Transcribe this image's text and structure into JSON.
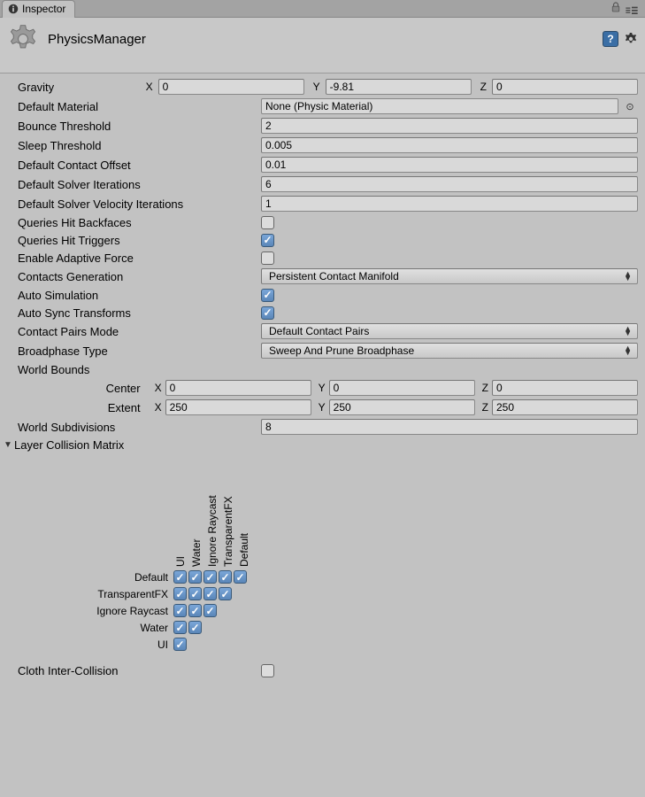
{
  "tab": {
    "title": "Inspector"
  },
  "header": {
    "title": "PhysicsManager"
  },
  "labels": {
    "gravity": "Gravity",
    "default_material": "Default Material",
    "bounce_threshold": "Bounce Threshold",
    "sleep_threshold": "Sleep Threshold",
    "default_contact_offset": "Default Contact Offset",
    "default_solver_iterations": "Default Solver Iterations",
    "default_solver_velocity_iterations": "Default Solver Velocity Iterations",
    "queries_hit_backfaces": "Queries Hit Backfaces",
    "queries_hit_triggers": "Queries Hit Triggers",
    "enable_adaptive_force": "Enable Adaptive Force",
    "contacts_generation": "Contacts Generation",
    "auto_simulation": "Auto Simulation",
    "auto_sync_transforms": "Auto Sync Transforms",
    "contact_pairs_mode": "Contact Pairs Mode",
    "broadphase_type": "Broadphase Type",
    "world_bounds": "World Bounds",
    "center": "Center",
    "extent": "Extent",
    "world_subdivisions": "World Subdivisions",
    "layer_collision_matrix": "Layer Collision Matrix",
    "cloth_inter_collision": "Cloth Inter-Collision",
    "x": "X",
    "y": "Y",
    "z": "Z"
  },
  "values": {
    "gravity": {
      "x": "0",
      "y": "-9.81",
      "z": "0"
    },
    "default_material": "None (Physic Material)",
    "bounce_threshold": "2",
    "sleep_threshold": "0.005",
    "default_contact_offset": "0.01",
    "default_solver_iterations": "6",
    "default_solver_velocity_iterations": "1",
    "queries_hit_backfaces": false,
    "queries_hit_triggers": true,
    "enable_adaptive_force": false,
    "contacts_generation": "Persistent Contact Manifold",
    "auto_simulation": true,
    "auto_sync_transforms": true,
    "contact_pairs_mode": "Default Contact Pairs",
    "broadphase_type": "Sweep And Prune Broadphase",
    "world_bounds": {
      "center": {
        "x": "0",
        "y": "0",
        "z": "0"
      },
      "extent": {
        "x": "250",
        "y": "250",
        "z": "250"
      }
    },
    "world_subdivisions": "8",
    "cloth_inter_collision": false
  },
  "matrix": {
    "layers": [
      "Default",
      "TransparentFX",
      "Ignore Raycast",
      "Water",
      "UI"
    ],
    "cells": [
      [
        true,
        true,
        true,
        true,
        true
      ],
      [
        true,
        true,
        true,
        true
      ],
      [
        true,
        true,
        true
      ],
      [
        true,
        true
      ],
      [
        true
      ]
    ]
  }
}
